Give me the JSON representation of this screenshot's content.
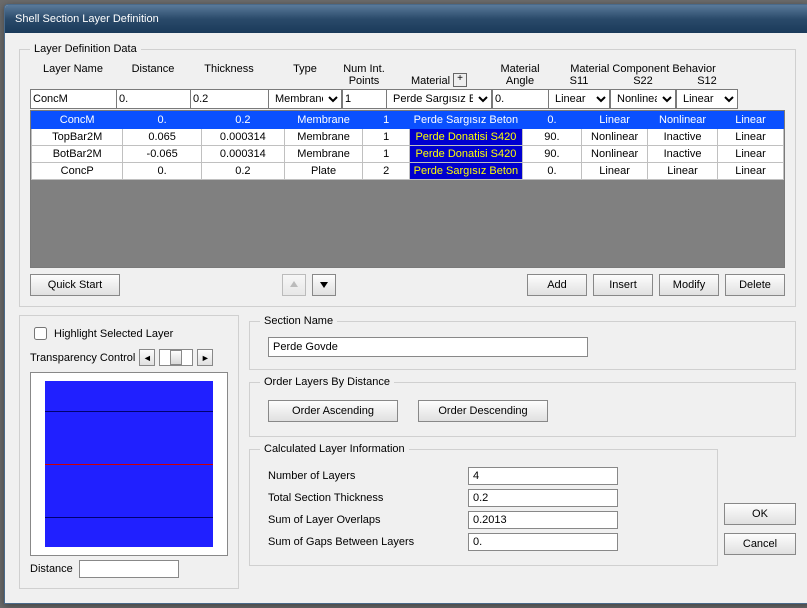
{
  "window": {
    "title": "Shell Section Layer Definition"
  },
  "fieldset_main": "Layer Definition Data",
  "headers": {
    "name": "Layer Name",
    "dist": "Distance",
    "thick": "Thickness",
    "type": "Type",
    "pts": "Num Int.\nPoints",
    "mat": "Material",
    "mat_plus": "+",
    "ang": "Material\nAngle",
    "comp": "Material Component Behavior",
    "s11": "S11",
    "s22": "S22",
    "s12": "S12"
  },
  "inputs": {
    "name": "ConcM",
    "dist": "0.",
    "thick": "0.2",
    "type": "Membrane",
    "pts": "1",
    "mat": "Perde Sargısız B",
    "ang": "0.",
    "s11": "Linear",
    "s22": "Nonlinear",
    "s12": "Linear"
  },
  "rows": [
    {
      "sel": true,
      "name": "ConcM",
      "dist": "0.",
      "thick": "0.2",
      "type": "Membrane",
      "pts": "1",
      "mat": "Perde Sargısız Beton",
      "matBlue": false,
      "ang": "0.",
      "s11": "Linear",
      "s22": "Nonlinear",
      "s12": "Linear"
    },
    {
      "sel": false,
      "name": "TopBar2M",
      "dist": "0.065",
      "thick": "0.000314",
      "type": "Membrane",
      "pts": "1",
      "mat": "Perde Donatisi S420",
      "matBlue": true,
      "ang": "90.",
      "s11": "Nonlinear",
      "s22": "Inactive",
      "s12": "Linear"
    },
    {
      "sel": false,
      "name": "BotBar2M",
      "dist": "-0.065",
      "thick": "0.000314",
      "type": "Membrane",
      "pts": "1",
      "mat": "Perde Donatisi S420",
      "matBlue": true,
      "ang": "90.",
      "s11": "Nonlinear",
      "s22": "Inactive",
      "s12": "Linear"
    },
    {
      "sel": false,
      "name": "ConcP",
      "dist": "0.",
      "thick": "0.2",
      "type": "Plate",
      "pts": "2",
      "mat": "Perde Sargısız Beton",
      "matBlue": true,
      "ang": "0.",
      "s11": "Linear",
      "s22": "Linear",
      "s12": "Linear"
    }
  ],
  "btns": {
    "quick_start": "Quick Start",
    "add": "Add",
    "insert": "Insert",
    "modify": "Modify",
    "delete": "Delete",
    "ok": "OK",
    "cancel": "Cancel",
    "order_asc": "Order Ascending",
    "order_desc": "Order Descending"
  },
  "left": {
    "highlight": "Highlight Selected Layer",
    "transparency": "Transparency Control",
    "distance": "Distance",
    "distance_val": ""
  },
  "section_name": {
    "legend": "Section Name",
    "value": "Perde Govde"
  },
  "order": {
    "legend": "Order Layers By Distance"
  },
  "calc": {
    "legend": "Calculated Layer Information",
    "num_layers_l": "Number of Layers",
    "num_layers_v": "4",
    "total_thick_l": "Total Section Thickness",
    "total_thick_v": "0.2",
    "overlaps_l": "Sum of Layer Overlaps",
    "overlaps_v": "0.2013",
    "gaps_l": "Sum of Gaps Between Layers",
    "gaps_v": "0."
  }
}
